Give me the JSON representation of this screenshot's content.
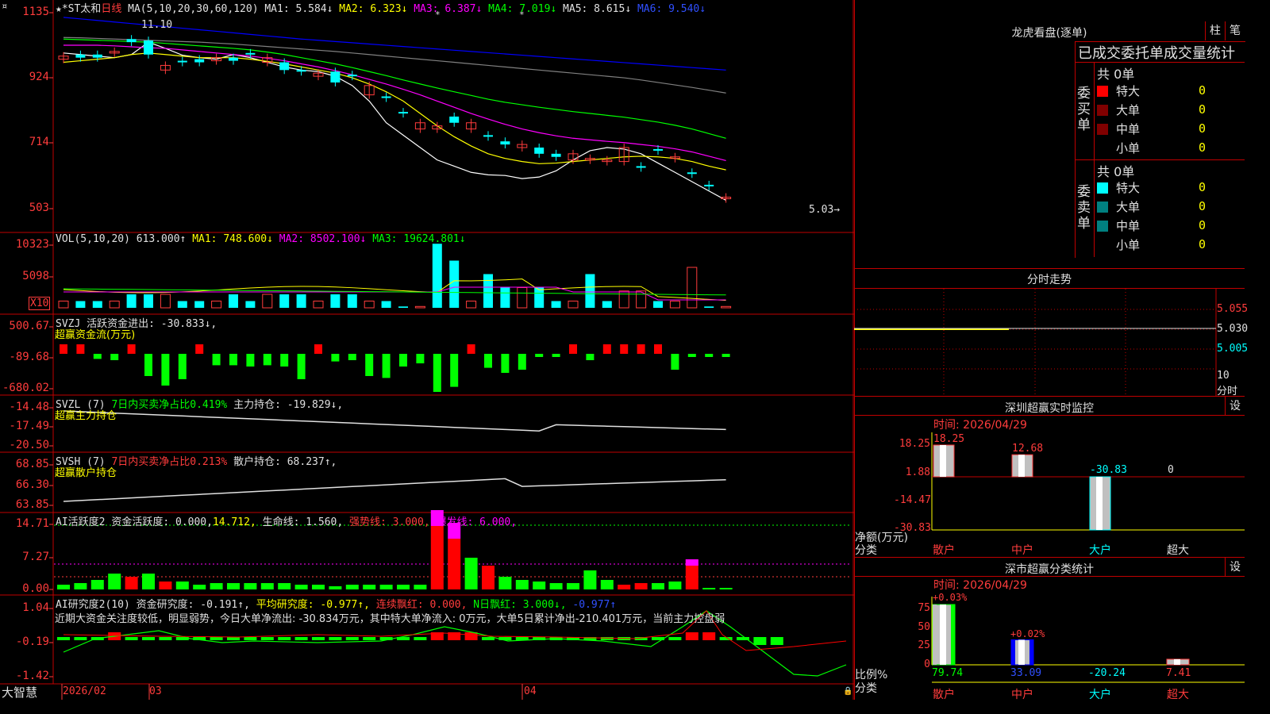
{
  "app": {
    "brand": "大智慧"
  },
  "price_panel": {
    "stock": "★*ST太和",
    "period": "日线",
    "ma_label": "MA(5,10,20,30,60,120)",
    "ma1": "MA1: 5.584↓",
    "ma2": "MA2: 6.323↓",
    "ma3": "MA3: 6.387↓",
    "ma4": "MA4: 7.019↓",
    "ma5": "MA5: 8.615↓",
    "ma6": "MA6: 9.540↓",
    "yticks": [
      "1135",
      "924",
      "714",
      "503"
    ],
    "high_label": "11.10",
    "low_label": "5.03→",
    "colors": {
      "ma1": "#ffffff",
      "ma2": "#ffff00",
      "ma3": "#ff00ff",
      "ma4": "#00ff00",
      "ma5": "#808080",
      "ma6": "#0000ff"
    }
  },
  "vol_panel": {
    "label": "VOL(5,10,20)",
    "value": "613.000↑",
    "ma1": "MA1: 748.600↓",
    "ma2": "MA2: 8502.100↓",
    "ma3": "MA3: 19624.801↓",
    "yticks": [
      "10323",
      "5098"
    ],
    "unit": "X10"
  },
  "svzj_panel": {
    "label": "SVZJ",
    "desc": "活跃资金进出: -30.833↓,",
    "sub": "超赢资金流(万元)",
    "yticks": [
      "500.67",
      "-89.68",
      "-680.02"
    ]
  },
  "svzl_panel": {
    "label": "SVZL (7)",
    "desc1": "7日内买卖净占比0.419%",
    "desc2": "主力持仓: -19.829↓,",
    "sub": "超赢主力持仓",
    "yticks": [
      "-14.48",
      "-17.49",
      "-20.50"
    ]
  },
  "svsh_panel": {
    "label": "SVSH (7)",
    "desc1": "7日内买卖净占比0.213%",
    "desc2": "散户持仓: 68.237↑,",
    "sub": "超赢散户持仓",
    "yticks": [
      "68.85",
      "66.30",
      "63.85"
    ]
  },
  "ai_active": {
    "label": "AI活跃度2",
    "d1": "资金活跃度: 0.000,",
    "d2": "14.712,",
    "d3": "生命线: 1.560,",
    "d4": "强势线: 3.000,",
    "d5": "爆发线: 6.000,",
    "yticks": [
      "14.71",
      "7.27",
      "0.00"
    ]
  },
  "ai_research": {
    "label": "AI研究度2(10)",
    "d1": "资金研究度: -0.191↑,",
    "d2": "平均研究度: -0.977↑,",
    "d3": "连续飘红: 0.000,",
    "d4": "N日飘红: 3.000↓,",
    "d5": "-0.977↑",
    "comment": "近期大资金关注度较低，明显弱势，今日大单净流出: -30.834万元，其中特大单净流入: 0万元，大单5日累计净出-210.401万元，当前主力控盘弱",
    "yticks": [
      "1.04",
      "-0.19",
      "-1.42"
    ]
  },
  "date_axis": {
    "labels": [
      "2026/02",
      "03",
      "04"
    ]
  },
  "dragon": {
    "title": "龙虎看盘(逐单)",
    "btn1": "柱",
    "btn2": "笔",
    "tabs": "已成交委托单成交量统计",
    "buy": {
      "side": "委买单",
      "total": "共 0单",
      "rows": [
        {
          "name": "特大",
          "value": "0",
          "color": "#ff0000"
        },
        {
          "name": "大单",
          "value": "0",
          "color": "#800000"
        },
        {
          "name": "中单",
          "value": "0",
          "color": "#800000"
        },
        {
          "name": "小单",
          "value": "0",
          "color": ""
        }
      ]
    },
    "sell": {
      "side": "委卖单",
      "total": "共 0单",
      "rows": [
        {
          "name": "特大",
          "value": "0",
          "color": "#00ffff"
        },
        {
          "name": "大单",
          "value": "0",
          "color": "#008080"
        },
        {
          "name": "中单",
          "value": "0",
          "color": "#008080"
        },
        {
          "name": "小单",
          "value": "0",
          "color": ""
        }
      ]
    }
  },
  "intraday": {
    "title": "分时走势",
    "yticks": [
      "5.055",
      "5.030",
      "5.005"
    ],
    "bottom_num": "10",
    "bottom_label": "分时"
  },
  "sz_monitor": {
    "title": "深圳超赢实时监控",
    "btn": "设",
    "time": "时间: 2026/04/29",
    "yticks": [
      "18.25",
      "1.88",
      "-14.47",
      "-30.83"
    ],
    "ylabel": "净额(万元)",
    "xlabel": "分类",
    "categories": [
      "散户",
      "中户",
      "大户",
      "超大"
    ],
    "values": [
      "18.25",
      "12.68",
      "-30.83",
      "0"
    ]
  },
  "sz_class": {
    "title": "深市超赢分类统计",
    "btn": "设",
    "time": "时间: 2026/04/29",
    "yticks": [
      "75",
      "50",
      "25",
      "0"
    ],
    "ylabel": "比例%",
    "xlabel": "分类",
    "categories": [
      "散户",
      "中户",
      "大户",
      "超大"
    ],
    "top_labels": [
      "+0.03%",
      "+0.02%",
      "",
      ""
    ],
    "values": [
      "79.74",
      "33.09",
      "-20.24",
      "7.41"
    ]
  },
  "chart_data": [
    {
      "type": "bar",
      "title": "深圳超赢实时监控",
      "xlabel": "分类",
      "ylabel": "净额(万元)",
      "categories": [
        "散户",
        "中户",
        "大户",
        "超大"
      ],
      "values": [
        18.25,
        12.68,
        -30.83,
        0
      ],
      "ylim": [
        -30.83,
        18.25
      ]
    },
    {
      "type": "bar",
      "title": "深市超赢分类统计",
      "xlabel": "分类",
      "ylabel": "比例%",
      "categories": [
        "散户",
        "中户",
        "大户",
        "超大"
      ],
      "values": [
        79.74,
        33.09,
        -20.24,
        7.41
      ],
      "ylim": [
        0,
        75
      ]
    },
    {
      "type": "line",
      "title": "",
      "series": [
        {
          "name": "MA1",
          "values": [
            1005,
            1000,
            995,
            990,
            1000,
            1040,
            1020,
            998,
            990,
            985,
            1000,
            990,
            975,
            960,
            950,
            945,
            930,
            900,
            850,
            780,
            740,
            700,
            660,
            640,
            620,
            612,
            610,
            600,
            605,
            625,
            660,
            690,
            700,
            695,
            680,
            650,
            620,
            590,
            560,
            530
          ]
        },
        {
          "name": "MA2",
          "values": [
            975,
            980,
            985,
            990,
            1000,
            1005,
            1000,
            995,
            990,
            990,
            990,
            985,
            978,
            970,
            960,
            950,
            940,
            925,
            905,
            880,
            850,
            810,
            770,
            735,
            705,
            680,
            665,
            655,
            648,
            650,
            655,
            660,
            665,
            670,
            672,
            670,
            665,
            655,
            640,
            628
          ]
        },
        {
          "name": "MA3",
          "values": [
            1030,
            1030,
            1030,
            1028,
            1025,
            1022,
            1020,
            1015,
            1010,
            1005,
            1000,
            995,
            988,
            980,
            970,
            960,
            948,
            935,
            920,
            905,
            888,
            870,
            850,
            830,
            810,
            792,
            775,
            760,
            748,
            738,
            730,
            725,
            720,
            716,
            710,
            704,
            696,
            686,
            672,
            658
          ]
        },
        {
          "name": "MA4",
          "values": [
            1050,
            1048,
            1046,
            1044,
            1042,
            1040,
            1036,
            1032,
            1028,
            1024,
            1020,
            1015,
            1008,
            1000,
            990,
            980,
            970,
            958,
            945,
            932,
            918,
            905,
            892,
            880,
            868,
            856,
            846,
            838,
            830,
            823,
            816,
            810,
            804,
            798,
            790,
            782,
            772,
            760,
            745,
            730
          ]
        },
        {
          "name": "MA5",
          "values": [
            1055,
            1054,
            1052,
            1050,
            1048,
            1046,
            1044,
            1042,
            1040,
            1037,
            1034,
            1030,
            1026,
            1022,
            1018,
            1014,
            1010,
            1005,
            1000,
            995,
            990,
            985,
            980,
            975,
            970,
            965,
            960,
            955,
            950,
            945,
            940,
            935,
            930,
            925,
            918,
            910,
            902,
            894,
            885,
            876
          ]
        },
        {
          "name": "MA6",
          "values": [
            1120,
            1115,
            1110,
            1105,
            1100,
            1095,
            1090,
            1085,
            1080,
            1075,
            1070,
            1065,
            1060,
            1055,
            1050,
            1046,
            1042,
            1038,
            1034,
            1030,
            1026,
            1022,
            1018,
            1014,
            1010,
            1006,
            1002,
            998,
            994,
            990,
            986,
            982,
            978,
            974,
            970,
            966,
            962,
            958,
            954,
            950
          ]
        }
      ]
    }
  ]
}
